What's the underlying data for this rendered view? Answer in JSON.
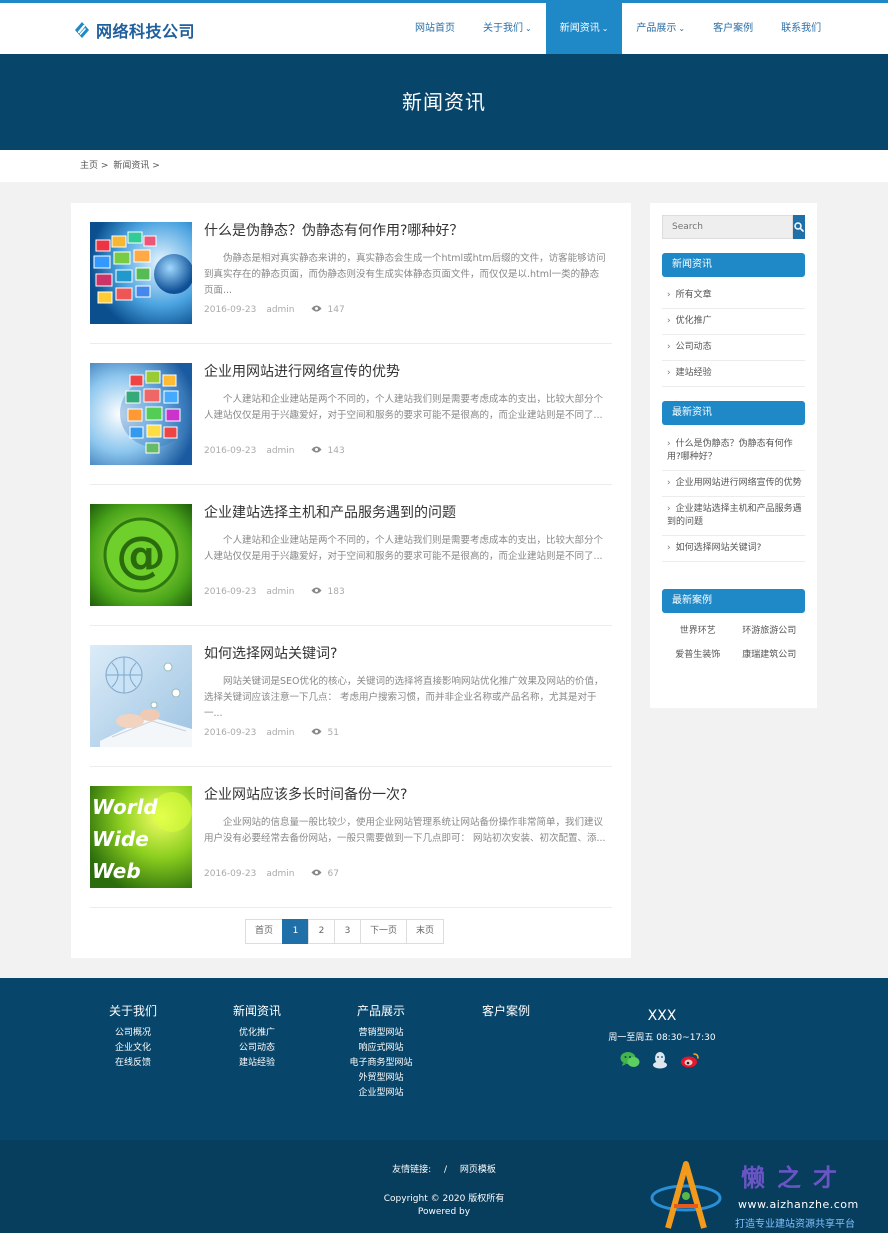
{
  "logo": {
    "text": "网络科技公司"
  },
  "nav": [
    {
      "label": "网站首页",
      "caret": ""
    },
    {
      "label": "关于我们",
      "caret": "⌄"
    },
    {
      "label": "新闻资讯",
      "caret": "⌄"
    },
    {
      "label": "产品展示",
      "caret": "⌄"
    },
    {
      "label": "客户案例",
      "caret": ""
    },
    {
      "label": "联系我们",
      "caret": ""
    }
  ],
  "banner": {
    "title": "新闻资讯"
  },
  "breadcrumb": {
    "home": "主页",
    "sep1": ">",
    "current": "新闻资讯",
    "sep2": ">"
  },
  "articles": [
    {
      "title": "什么是伪静态？伪静态有何作用?哪种好？",
      "summary": "伪静态是相对真实静态来讲的，真实静态会生成一个html或htm后缀的文件，访客能够访问到真实存在的静态页面，而伪静态则没有生成实体静态页面文件，而仅仅是以.html一类的静态页面...",
      "date": "2016-09-23",
      "author": "admin",
      "views": "147"
    },
    {
      "title": "企业用网站进行网络宣传的优势",
      "summary": "个人建站和企业建站是两个不同的，个人建站我们则是需要考虑成本的支出，比较大部分个人建站仅仅是用于兴趣爱好，对于空间和服务的要求可能不是很高的，而企业建站则是不同了...",
      "date": "2016-09-23",
      "author": "admin",
      "views": "143"
    },
    {
      "title": "企业建站选择主机和产品服务遇到的问题",
      "summary": "个人建站和企业建站是两个不同的，个人建站我们则是需要考虑成本的支出，比较大部分个人建站仅仅是用于兴趣爱好，对于空间和服务的要求可能不是很高的，而企业建站则是不同了...",
      "date": "2016-09-23",
      "author": "admin",
      "views": "183"
    },
    {
      "title": "如何选择网站关键词?",
      "summary": "网站关键词是SEO优化的核心，关键词的选择将直接影响网站优化推广效果及网站的价值，选择关键词应该注意一下几点： 考虑用户搜索习惯，而并非企业名称或产品名称，尤其是对于一...",
      "date": "2016-09-23",
      "author": "admin",
      "views": "51"
    },
    {
      "title": "企业网站应该多长时间备份一次?",
      "summary": "企业网站的信息量一般比较少，使用企业网站管理系统让网站备份操作非常简单，我们建议用户没有必要经常去备份网站，一般只需要做到一下几点即可： 网站初次安装、初次配置、添...",
      "date": "2016-09-23",
      "author": "admin",
      "views": "67"
    }
  ],
  "pager": [
    "首页",
    "1",
    "2",
    "3",
    "下一页",
    "末页"
  ],
  "sidebar": {
    "search_placeholder": "Search",
    "news_head": "新闻资讯",
    "news_items": [
      "所有文章",
      "优化推广",
      "公司动态",
      "建站经验"
    ],
    "latest_head": "最新资讯",
    "latest_items": [
      "什么是伪静态？伪静态有何作用?哪种好？",
      "企业用网站进行网络宣传的优势",
      "企业建站选择主机和产品服务遇到的问题",
      "如何选择网站关键词?"
    ],
    "cases_head": "最新案例",
    "cases": [
      "世界环艺",
      "环游旅游公司",
      "爱普生装饰",
      "康瑞建筑公司"
    ]
  },
  "footer": {
    "cols": [
      {
        "title": "关于我们",
        "items": [
          "公司概况",
          "企业文化",
          "在线反馈"
        ]
      },
      {
        "title": "新闻资讯",
        "items": [
          "优化推广",
          "公司动态",
          "建站经验"
        ]
      },
      {
        "title": "产品展示",
        "items": [
          "营销型网站",
          "响应式网站",
          "电子商务型网站",
          "外贸型网站",
          "企业型网站"
        ]
      },
      {
        "title": "客户案例",
        "items": []
      }
    ],
    "contact_name": "XXX",
    "contact_hours": "周一至周五 08:30~17:30",
    "links_label": "友情链接:",
    "links_sep": "/",
    "links_item": "网页模板",
    "copyright": "Copyright © 2020 版权所有",
    "powered": "Powered by"
  },
  "watermark": {
    "title": "懒之才",
    "url": "www.aizhanzhe.com",
    "sub": "打造专业建站资源共享平台"
  },
  "colors": {
    "brand": "#1f88c7",
    "dark": "#08456a",
    "active_page": "#1f6fa8"
  }
}
